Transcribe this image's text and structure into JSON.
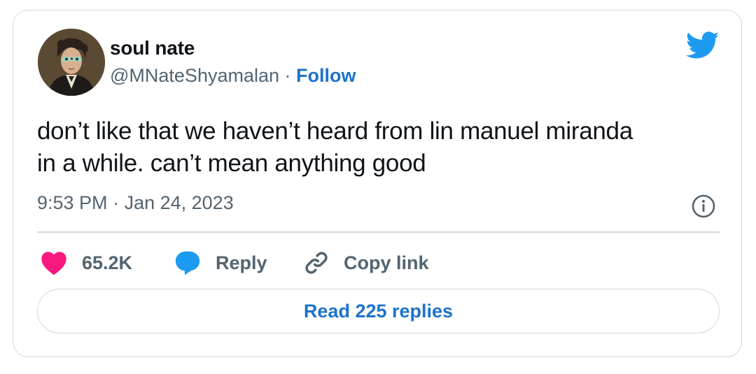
{
  "user": {
    "display_name": "soul nate",
    "handle": "@MNateShyamalan",
    "separator": "·",
    "follow_label": "Follow"
  },
  "tweet": {
    "line1": "don’t like that we haven’t heard from lin manuel miranda",
    "line2": "in a while. can’t mean anything good",
    "time": "9:53 PM",
    "date_separator": "·",
    "date": "Jan 24, 2023"
  },
  "actions": {
    "like_count": "65.2K",
    "reply_label": "Reply",
    "copy_link_label": "Copy link"
  },
  "read_replies_label": "Read 225 replies",
  "icons": {
    "avatar": "avatar-portrait",
    "brand": "twitter-bird-icon",
    "info": "info-icon",
    "like": "heart-icon",
    "reply": "speech-bubble-icon",
    "copy": "link-icon"
  },
  "colors": {
    "brand_blue": "#1d9bf0",
    "link_blue": "#1d73c9",
    "heart_pink": "#f91880",
    "secondary_text": "#536471",
    "border": "#cfd9de"
  }
}
